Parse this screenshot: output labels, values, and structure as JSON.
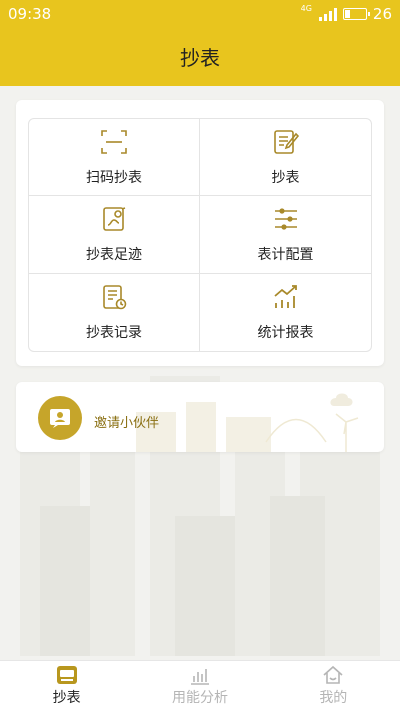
{
  "status_bar": {
    "time": "09:38",
    "network_tag": "4G",
    "battery_level": "26"
  },
  "header": {
    "title": "抄表"
  },
  "menu": {
    "items": [
      {
        "label": "扫码抄表",
        "icon": "scan-icon"
      },
      {
        "label": "抄表",
        "icon": "edit-meter-icon"
      },
      {
        "label": "抄表足迹",
        "icon": "footprint-icon"
      },
      {
        "label": "表计配置",
        "icon": "config-sliders-icon"
      },
      {
        "label": "抄表记录",
        "icon": "record-icon"
      },
      {
        "label": "统计报表",
        "icon": "stats-chart-icon"
      }
    ]
  },
  "invite": {
    "label": "邀请小伙伴",
    "icon": "invite-card-icon"
  },
  "bottom_nav": {
    "items": [
      {
        "label": "抄表",
        "icon": "meter-icon",
        "active": true
      },
      {
        "label": "用能分析",
        "icon": "bar-chart-icon",
        "active": false
      },
      {
        "label": "我的",
        "icon": "home-icon",
        "active": false
      }
    ]
  },
  "colors": {
    "header_bg": "#e8c51e",
    "icon_gold": "#a8892a",
    "invite_circle": "#c6a52a",
    "invite_text": "#8a6f12",
    "inactive_nav": "#b5b5b5"
  }
}
